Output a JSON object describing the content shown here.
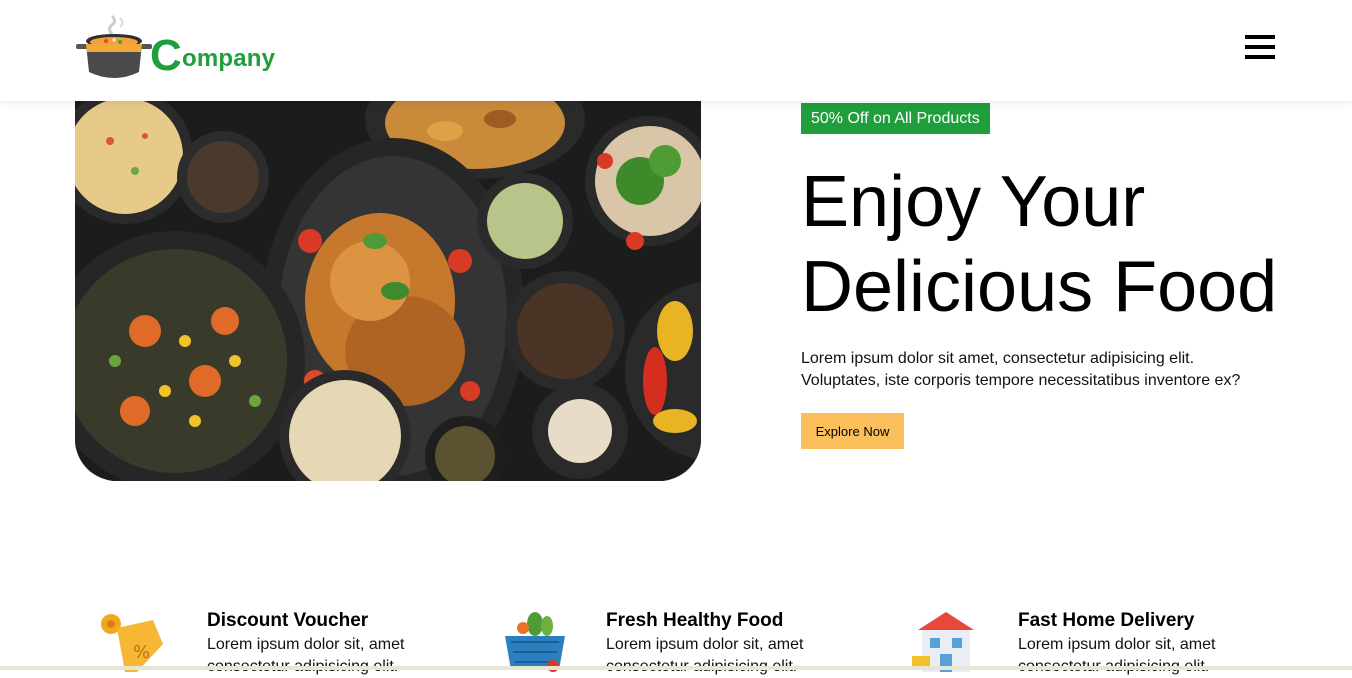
{
  "header": {
    "logo_text_initial": "C",
    "logo_text_rest": "ompany",
    "menu_icon": "hamburger-menu-icon"
  },
  "hero": {
    "badge": "50% Off on All Products",
    "title_line1": "Enjoy Your",
    "title_line2": "Delicious Food",
    "description_line1": "Lorem ipsum dolor sit amet, consectetur adipisicing elit.",
    "description_line2": "Voluptates, iste corporis tempore necessitatibus inventore ex?",
    "cta": "Explore Now",
    "image": "roast-chicken-and-dishes-photo"
  },
  "features": [
    {
      "icon": "discount-voucher-icon",
      "title": "Discount Voucher",
      "line1": "Lorem ipsum dolor sit, amet",
      "line2": "consectetur adipisicing elit."
    },
    {
      "icon": "vegetable-basket-icon",
      "title": "Fresh Healthy Food",
      "line1": "Lorem ipsum dolor sit, amet",
      "line2": "consectetur adipisicing elit."
    },
    {
      "icon": "home-delivery-icon",
      "title": "Fast Home Delivery",
      "line1": "Lorem ipsum dolor sit, amet",
      "line2": "consectetur adipisicing elit."
    }
  ],
  "colors": {
    "brand_green": "#1f9e3b",
    "cta_yellow": "#fbbf5b"
  }
}
